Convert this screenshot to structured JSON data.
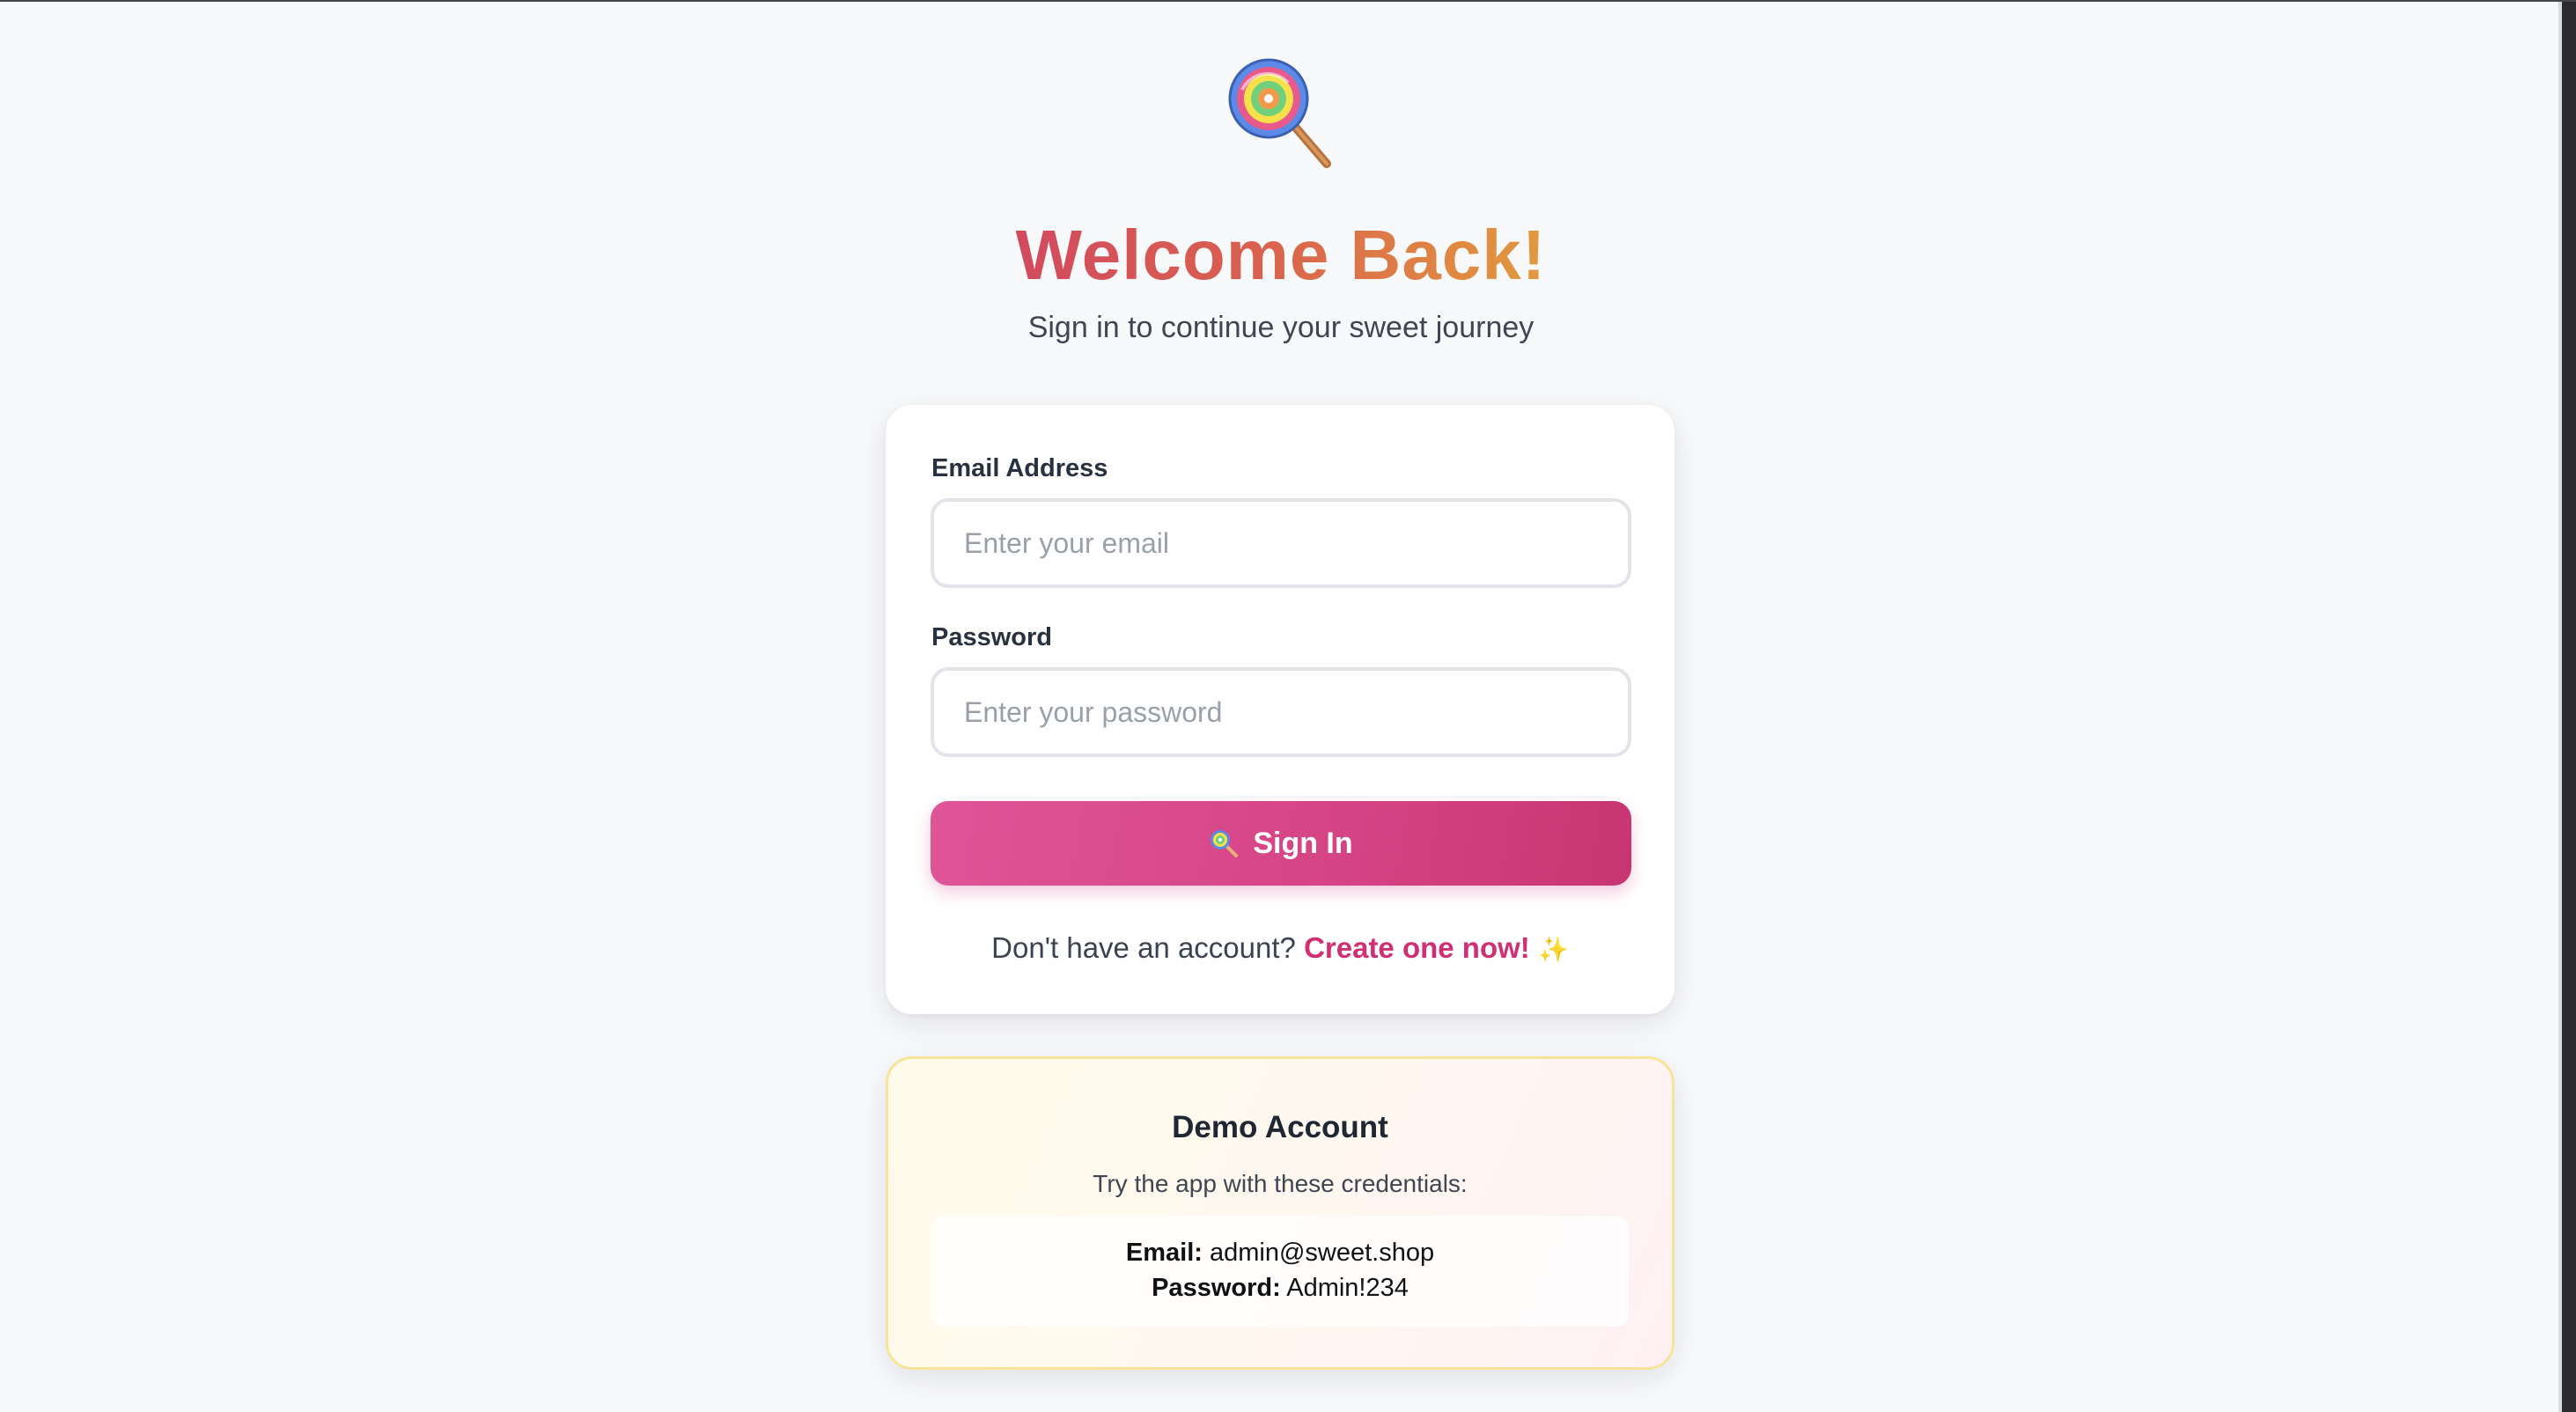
{
  "logo": {
    "icon": "lollipop-icon"
  },
  "header": {
    "title": "Welcome Back!",
    "subtitle": "Sign in to continue your sweet journey"
  },
  "form": {
    "email_label": "Email Address",
    "email_placeholder": "Enter your email",
    "email_value": "",
    "password_label": "Password",
    "password_placeholder": "Enter your password",
    "password_value": "",
    "submit_label": "Sign In",
    "submit_icon": "lollipop-icon",
    "signup_prompt": "Don't have an account?",
    "signup_link": "Create one now!",
    "signup_emoji": "✨"
  },
  "demo": {
    "title": "Demo Account",
    "subtitle": "Try the app with these credentials:",
    "email_label": "Email:",
    "email_value": "admin@sweet.shop",
    "password_label": "Password:",
    "password_value": "Admin!234"
  },
  "colors": {
    "accent": "#d64586",
    "link": "#d12f74",
    "title_gradient_start": "#d24a5e",
    "title_gradient_end": "#e29a3d",
    "demo_border": "#f7e49a"
  }
}
